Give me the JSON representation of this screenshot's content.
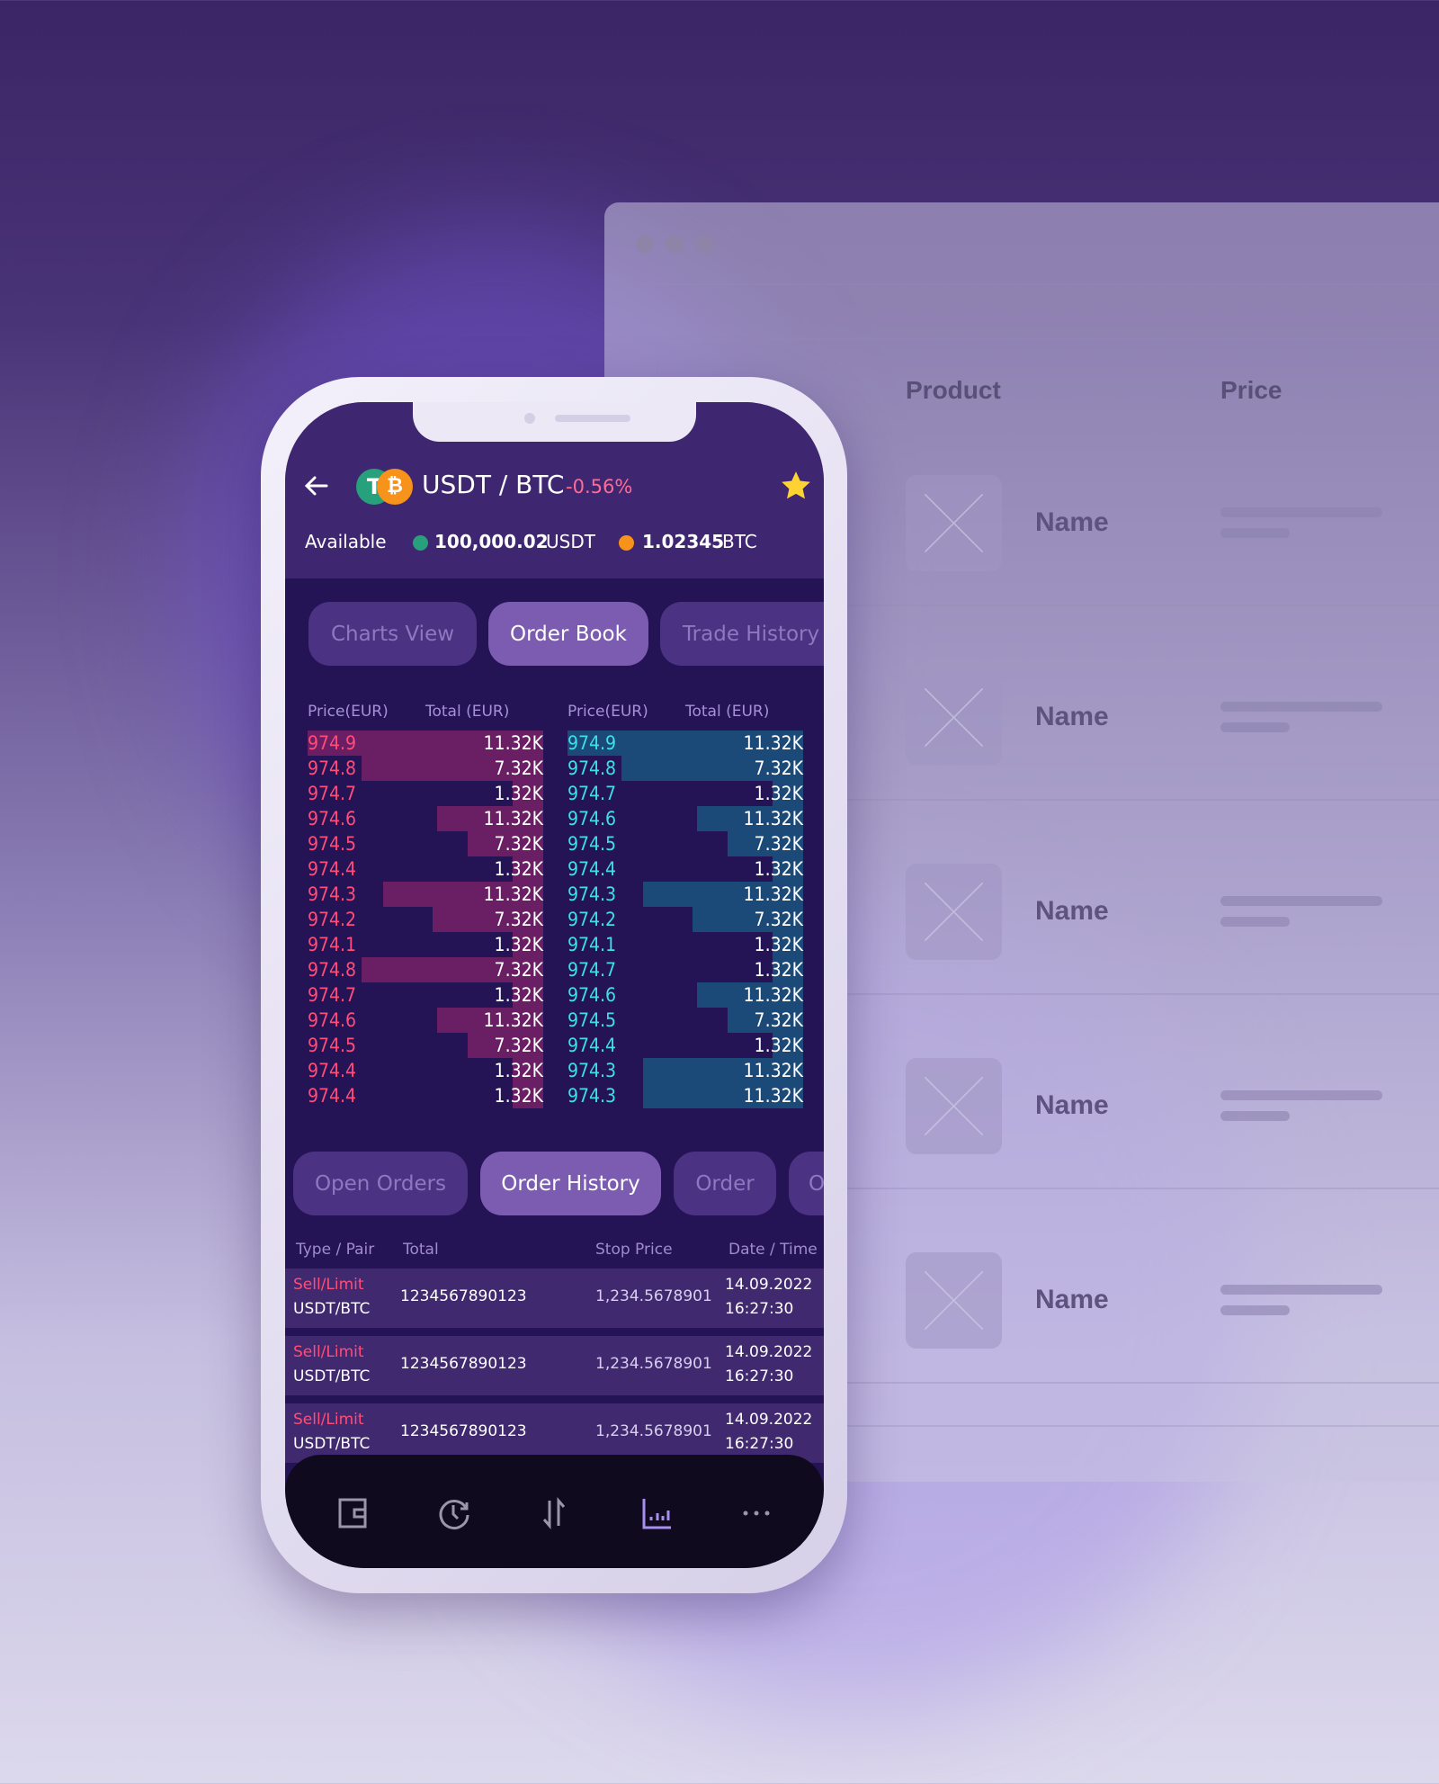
{
  "browser": {
    "columns": {
      "product": "Product",
      "price": "Price"
    },
    "rows": [
      {
        "name": "Name"
      },
      {
        "name": "Name"
      },
      {
        "name": "Name"
      },
      {
        "name": "Name"
      },
      {
        "name": "Name"
      }
    ]
  },
  "app": {
    "pair": "USDT / BTC",
    "change": "-0.56%",
    "favorite": true,
    "available_label": "Available",
    "usdt_amount": "100,000.02",
    "usdt_unit": "USDT",
    "btc_amount": "1.02345",
    "btc_unit": "BTC",
    "colors": {
      "sell": "#ff4d7a",
      "buy": "#3ee0e6",
      "usdt": "#26a17b",
      "btc": "#f7931a",
      "star": "#ffd233"
    },
    "tabs": [
      {
        "label": "Charts View",
        "active": false
      },
      {
        "label": "Order Book",
        "active": true
      },
      {
        "label": "Trade History",
        "active": false
      }
    ],
    "orderbook": {
      "headers": {
        "price": "Price(EUR)",
        "total": "Total (EUR)"
      },
      "asks": [
        {
          "price": "974.9",
          "total": "11.32K",
          "depth": 1.0
        },
        {
          "price": "974.8",
          "total": "7.32K",
          "depth": 0.77
        },
        {
          "price": "974.7",
          "total": "1.32K",
          "depth": 0.13
        },
        {
          "price": "974.6",
          "total": "11.32K",
          "depth": 0.45
        },
        {
          "price": "974.5",
          "total": "7.32K",
          "depth": 0.32
        },
        {
          "price": "974.4",
          "total": "1.32K",
          "depth": 0.13
        },
        {
          "price": "974.3",
          "total": "11.32K",
          "depth": 0.68
        },
        {
          "price": "974.2",
          "total": "7.32K",
          "depth": 0.47
        },
        {
          "price": "974.1",
          "total": "1.32K",
          "depth": 0.13
        },
        {
          "price": "974.8",
          "total": "7.32K",
          "depth": 0.77
        },
        {
          "price": "974.7",
          "total": "1.32K",
          "depth": 0.13
        },
        {
          "price": "974.6",
          "total": "11.32K",
          "depth": 0.45
        },
        {
          "price": "974.5",
          "total": "7.32K",
          "depth": 0.32
        },
        {
          "price": "974.4",
          "total": "1.32K",
          "depth": 0.13
        },
        {
          "price": "974.4",
          "total": "1.32K",
          "depth": 0.13
        }
      ],
      "bids": [
        {
          "price": "974.9",
          "total": "11.32K",
          "depth": 1.0
        },
        {
          "price": "974.8",
          "total": "7.32K",
          "depth": 0.77
        },
        {
          "price": "974.7",
          "total": "1.32K",
          "depth": 0.13
        },
        {
          "price": "974.6",
          "total": "11.32K",
          "depth": 0.45
        },
        {
          "price": "974.5",
          "total": "7.32K",
          "depth": 0.32
        },
        {
          "price": "974.4",
          "total": "1.32K",
          "depth": 0.13
        },
        {
          "price": "974.3",
          "total": "11.32K",
          "depth": 0.68
        },
        {
          "price": "974.2",
          "total": "7.32K",
          "depth": 0.47
        },
        {
          "price": "974.1",
          "total": "1.32K",
          "depth": 0.13
        },
        {
          "price": "974.7",
          "total": "1.32K",
          "depth": 0.13
        },
        {
          "price": "974.6",
          "total": "11.32K",
          "depth": 0.45
        },
        {
          "price": "974.5",
          "total": "7.32K",
          "depth": 0.32
        },
        {
          "price": "974.4",
          "total": "1.32K",
          "depth": 0.13
        },
        {
          "price": "974.3",
          "total": "11.32K",
          "depth": 0.68
        },
        {
          "price": "974.3",
          "total": "11.32K",
          "depth": 0.68
        }
      ]
    },
    "order_tabs": [
      {
        "label": "Open Orders",
        "active": false
      },
      {
        "label": "Order History",
        "active": true
      },
      {
        "label": "Order",
        "active": false
      },
      {
        "label": "O",
        "active": false
      }
    ],
    "orders": {
      "headers": {
        "type_pair": "Type / Pair",
        "total": "Total",
        "stop_price": "Stop Price",
        "date_time": "Date / Time"
      },
      "rows": [
        {
          "type": "Sell/Limit",
          "pair": "USDT/BTC",
          "total": "1234567890123",
          "stop_price": "1,234.5678901",
          "date": "14.09.2022",
          "time": "16:27:30"
        },
        {
          "type": "Sell/Limit",
          "pair": "USDT/BTC",
          "total": "1234567890123",
          "stop_price": "1,234.5678901",
          "date": "14.09.2022",
          "time": "16:27:30"
        },
        {
          "type": "Sell/Limit",
          "pair": "USDT/BTC",
          "total": "1234567890123",
          "stop_price": "1,234.5678901",
          "date": "14.09.2022",
          "time": "16:27:30"
        }
      ]
    },
    "nav": [
      {
        "icon": "wallet-icon"
      },
      {
        "icon": "history-icon"
      },
      {
        "icon": "exchange-icon"
      },
      {
        "icon": "chart-icon",
        "active": true
      },
      {
        "icon": "more-icon"
      }
    ]
  }
}
